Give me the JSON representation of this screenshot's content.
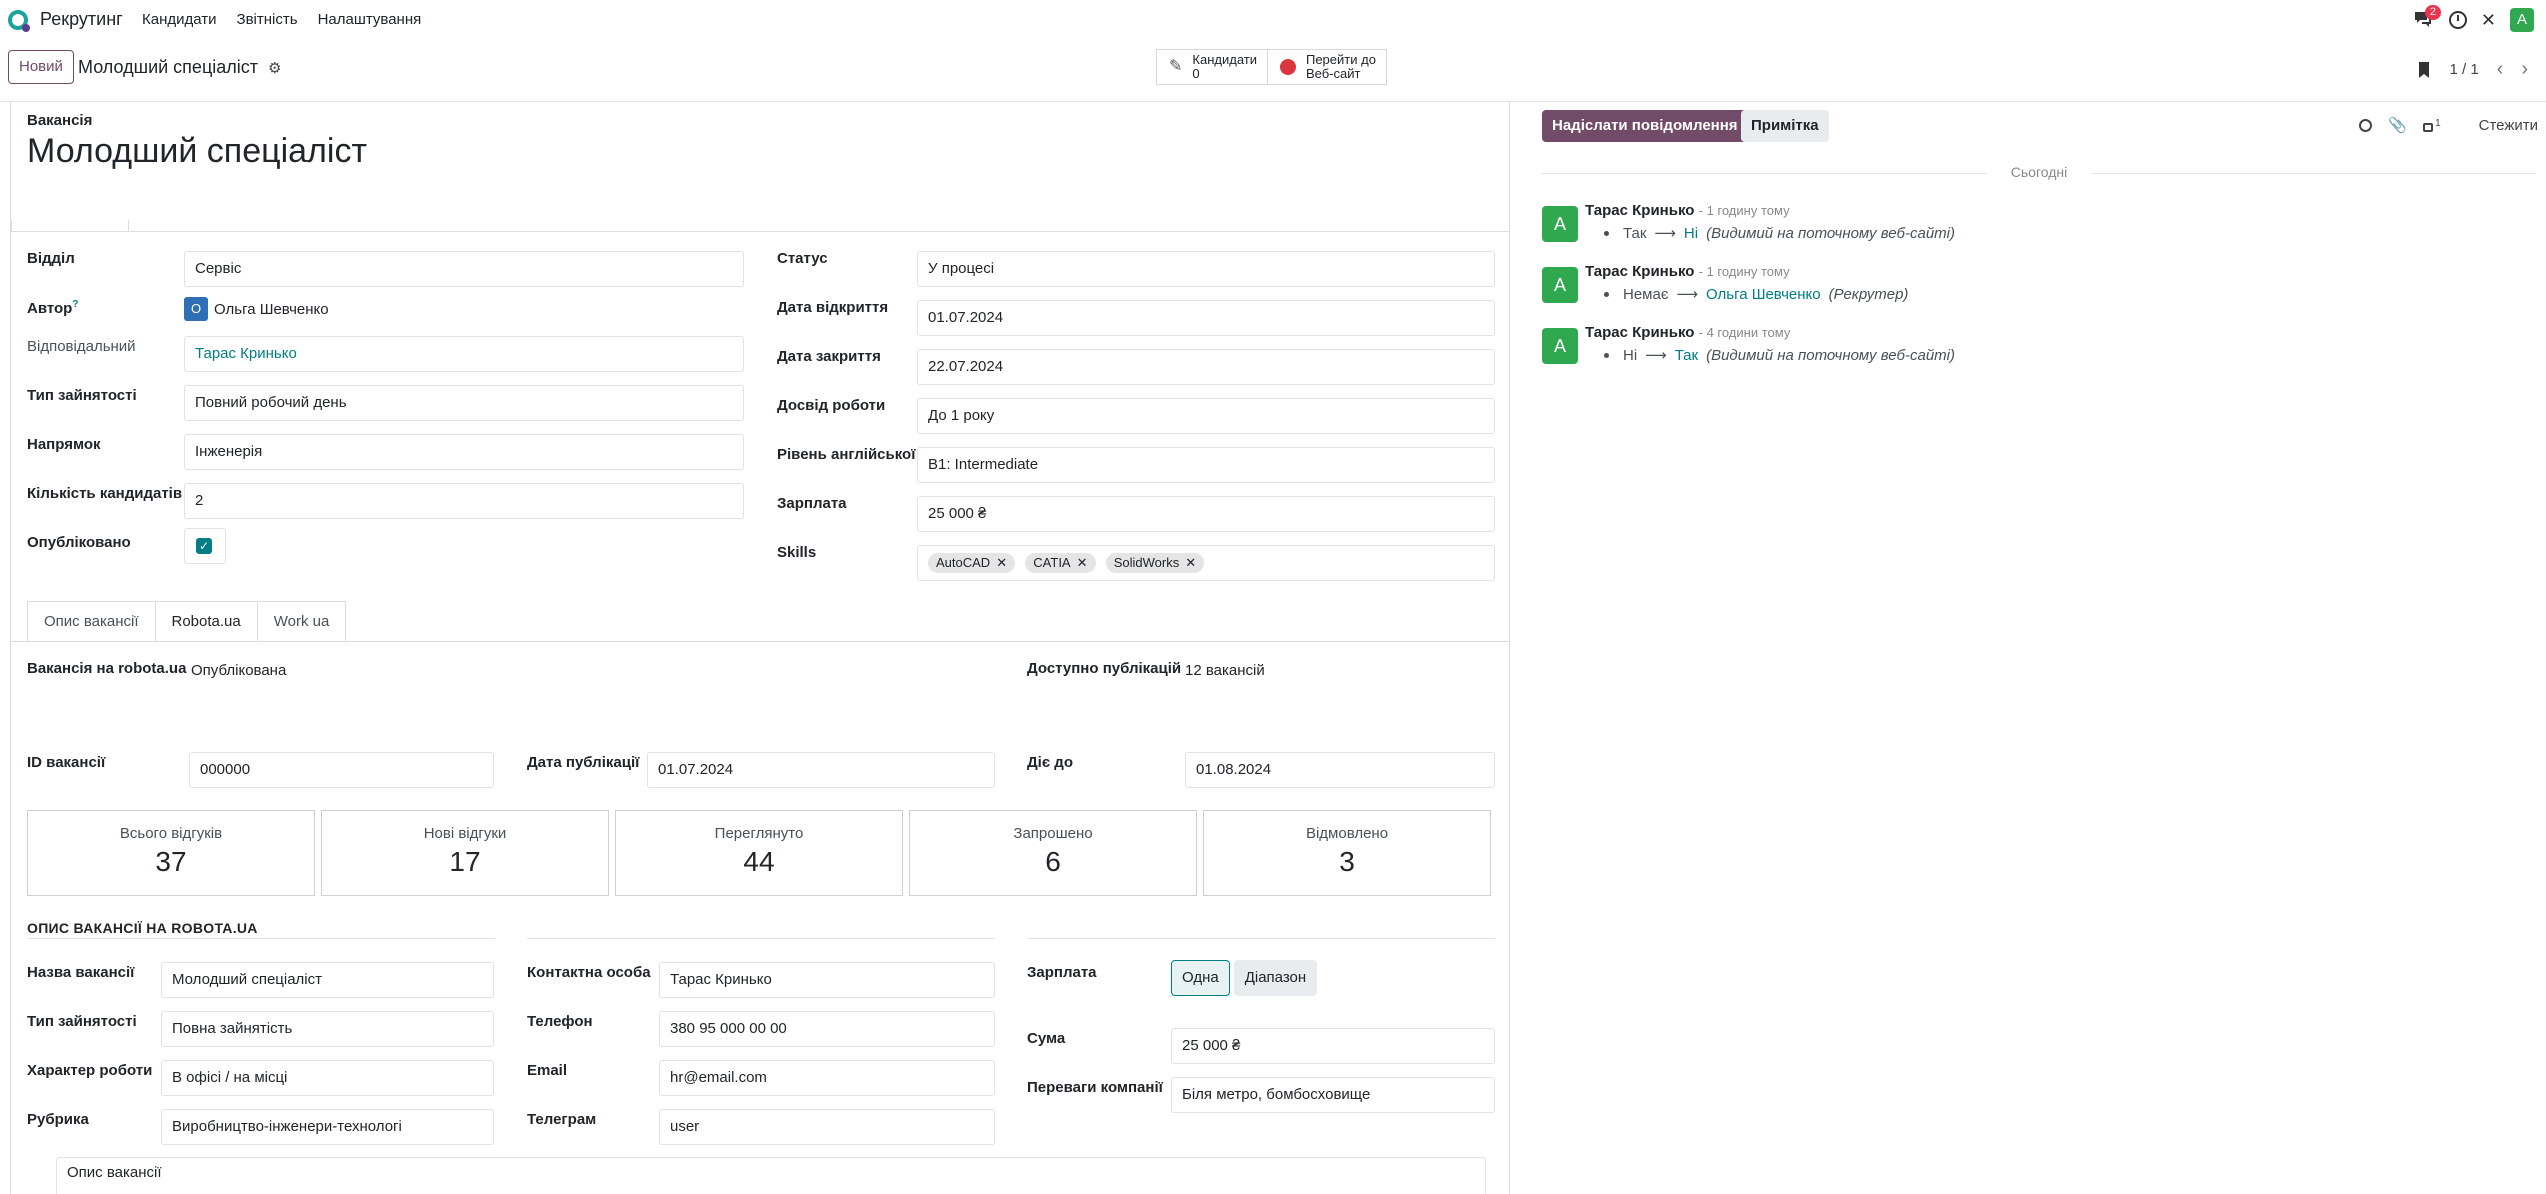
{
  "navbar": {
    "app_name": "Рекрутинг",
    "menu": [
      "Кандидати",
      "Звітність",
      "Налаштування"
    ],
    "chat_badge": "2",
    "user_initial": "A"
  },
  "control": {
    "new_label": "Новий",
    "breadcrumb_title": "Молодший спеціаліст",
    "smart_candidates_label": "Кандидати",
    "smart_candidates_count": "0",
    "smart_web_line1": "Перейти до",
    "smart_web_line2": "Веб-сайт",
    "pager": "1 / 1"
  },
  "form": {
    "vacancy_label": "Вакансія",
    "vacancy_title": "Молодший спеціаліст",
    "left": {
      "department_label": "Відділ",
      "department_value": "Сервіс",
      "author_label": "Автор",
      "author_hint": "?",
      "author_initial": "О",
      "author_value": "Ольга Шевченко",
      "responsible_label": "Відповідальний",
      "responsible_value": "Тарас Кринько",
      "employment_label": "Тип зайнятості",
      "employment_value": "Повний робочий день",
      "direction_label": "Напрямок",
      "direction_value": "Інженерія",
      "candidates_label": "Кількість кандидатів",
      "candidates_value": "2",
      "published_label": "Опубліковано"
    },
    "right": {
      "status_label": "Статус",
      "status_value": "У процесі",
      "open_date_label": "Дата відкриття",
      "open_date_value": "01.07.2024",
      "close_date_label": "Дата закриття",
      "close_date_value": "22.07.2024",
      "experience_label": "Досвід роботи",
      "experience_value": "До 1 року",
      "english_label": "Рівень англійської",
      "english_value": "B1: Intermediate",
      "salary_label": "Зарплата",
      "salary_value": "25 000 ₴",
      "skills_label": "Skills",
      "skills": [
        "AutoCAD",
        "CATIA",
        "SolidWorks"
      ]
    },
    "tabs": [
      "Опис вакансії",
      "Robota.ua",
      "Work ua"
    ],
    "robota": {
      "vacancy_on_label": "Вакансія на robota.ua",
      "vacancy_on_value": "Опублікована",
      "available_label": "Доступно публікацій",
      "available_value": "12 вакансій",
      "id_label": "ID вакансії",
      "id_value": "000000",
      "pub_date_label": "Дата публікації",
      "pub_date_value": "01.07.2024",
      "valid_label": "Діє до",
      "valid_value": "01.08.2024",
      "stats": [
        {
          "label": "Всього відгуків",
          "value": "37"
        },
        {
          "label": "Нові відгуки",
          "value": "17"
        },
        {
          "label": "Переглянуто",
          "value": "44"
        },
        {
          "label": "Запрошено",
          "value": "6"
        },
        {
          "label": "Відмовлено",
          "value": "3"
        }
      ],
      "section_title": "ОПИС ВАКАНСІЇ НА ROBOTA.UA",
      "name_label": "Назва вакансії",
      "name_value": "Молодший спеціаліст",
      "emp_type_label": "Тип зайнятості",
      "emp_type_value": "Повна зайнятість",
      "work_char_label": "Характер роботи",
      "work_char_value": "В офісі / на місці",
      "rubric_label": "Рубрика",
      "rubric_value": "Виробництво-інженери-технологі",
      "contact_label": "Контактна особа",
      "contact_value": "Тарас Кринько",
      "phone_label": "Телефон",
      "phone_value": "380 95 000 00 00",
      "email_label": "Email",
      "email_value": "hr@email.com",
      "telegram_label": "Телеграм",
      "telegram_value": "user",
      "salary_label": "Зарплата",
      "salary_opt_single": "Одна",
      "salary_opt_range": "Діапазон",
      "sum_label": "Сума",
      "sum_value": "25 000 ₴",
      "benefits_label": "Переваги компанії",
      "benefits_value": "Біля метро, бомбосховище",
      "description_placeholder": "Опис вакансії"
    }
  },
  "chatter": {
    "send_label": "Надіслати повідомлення",
    "note_label": "Примітка",
    "followers_count": "1",
    "follow_label": "Стежити",
    "today_label": "Сьогодні",
    "messages": [
      {
        "initial": "A",
        "author": "Тарас Кринько",
        "time": "- 1 годину тому",
        "old": "Так",
        "new": "Ні",
        "field": "(Видимий на поточному веб-сайті)"
      },
      {
        "initial": "A",
        "author": "Тарас Кринько",
        "time": "- 1 годину тому",
        "old": "Немає",
        "new": "Ольга Шевченко",
        "field": "(Рекрутер)"
      },
      {
        "initial": "A",
        "author": "Тарас Кринько",
        "time": "- 4 години тому",
        "old": "Ні",
        "new": "Так",
        "field": "(Видимий на поточному веб-сайті)"
      }
    ]
  },
  "colors": {
    "brand": "#714b67",
    "accent": "#017e84",
    "avatar_green": "#2fa84f"
  }
}
